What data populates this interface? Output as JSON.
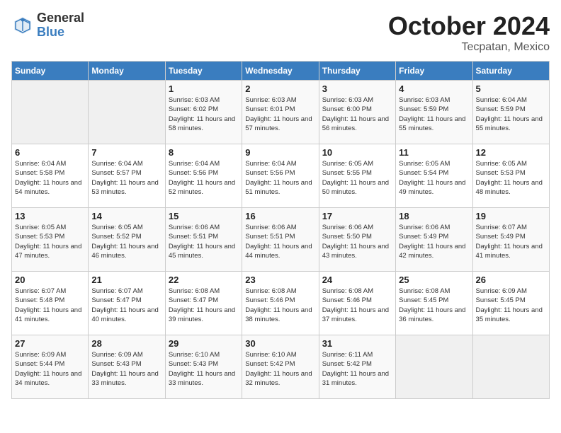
{
  "logo": {
    "general": "General",
    "blue": "Blue"
  },
  "title": "October 2024",
  "location": "Tecpatan, Mexico",
  "days_header": [
    "Sunday",
    "Monday",
    "Tuesday",
    "Wednesday",
    "Thursday",
    "Friday",
    "Saturday"
  ],
  "weeks": [
    [
      {
        "num": "",
        "info": ""
      },
      {
        "num": "",
        "info": ""
      },
      {
        "num": "1",
        "info": "Sunrise: 6:03 AM\nSunset: 6:02 PM\nDaylight: 11 hours and 58 minutes."
      },
      {
        "num": "2",
        "info": "Sunrise: 6:03 AM\nSunset: 6:01 PM\nDaylight: 11 hours and 57 minutes."
      },
      {
        "num": "3",
        "info": "Sunrise: 6:03 AM\nSunset: 6:00 PM\nDaylight: 11 hours and 56 minutes."
      },
      {
        "num": "4",
        "info": "Sunrise: 6:03 AM\nSunset: 5:59 PM\nDaylight: 11 hours and 55 minutes."
      },
      {
        "num": "5",
        "info": "Sunrise: 6:04 AM\nSunset: 5:59 PM\nDaylight: 11 hours and 55 minutes."
      }
    ],
    [
      {
        "num": "6",
        "info": "Sunrise: 6:04 AM\nSunset: 5:58 PM\nDaylight: 11 hours and 54 minutes."
      },
      {
        "num": "7",
        "info": "Sunrise: 6:04 AM\nSunset: 5:57 PM\nDaylight: 11 hours and 53 minutes."
      },
      {
        "num": "8",
        "info": "Sunrise: 6:04 AM\nSunset: 5:56 PM\nDaylight: 11 hours and 52 minutes."
      },
      {
        "num": "9",
        "info": "Sunrise: 6:04 AM\nSunset: 5:56 PM\nDaylight: 11 hours and 51 minutes."
      },
      {
        "num": "10",
        "info": "Sunrise: 6:05 AM\nSunset: 5:55 PM\nDaylight: 11 hours and 50 minutes."
      },
      {
        "num": "11",
        "info": "Sunrise: 6:05 AM\nSunset: 5:54 PM\nDaylight: 11 hours and 49 minutes."
      },
      {
        "num": "12",
        "info": "Sunrise: 6:05 AM\nSunset: 5:53 PM\nDaylight: 11 hours and 48 minutes."
      }
    ],
    [
      {
        "num": "13",
        "info": "Sunrise: 6:05 AM\nSunset: 5:53 PM\nDaylight: 11 hours and 47 minutes."
      },
      {
        "num": "14",
        "info": "Sunrise: 6:05 AM\nSunset: 5:52 PM\nDaylight: 11 hours and 46 minutes."
      },
      {
        "num": "15",
        "info": "Sunrise: 6:06 AM\nSunset: 5:51 PM\nDaylight: 11 hours and 45 minutes."
      },
      {
        "num": "16",
        "info": "Sunrise: 6:06 AM\nSunset: 5:51 PM\nDaylight: 11 hours and 44 minutes."
      },
      {
        "num": "17",
        "info": "Sunrise: 6:06 AM\nSunset: 5:50 PM\nDaylight: 11 hours and 43 minutes."
      },
      {
        "num": "18",
        "info": "Sunrise: 6:06 AM\nSunset: 5:49 PM\nDaylight: 11 hours and 42 minutes."
      },
      {
        "num": "19",
        "info": "Sunrise: 6:07 AM\nSunset: 5:49 PM\nDaylight: 11 hours and 41 minutes."
      }
    ],
    [
      {
        "num": "20",
        "info": "Sunrise: 6:07 AM\nSunset: 5:48 PM\nDaylight: 11 hours and 41 minutes."
      },
      {
        "num": "21",
        "info": "Sunrise: 6:07 AM\nSunset: 5:47 PM\nDaylight: 11 hours and 40 minutes."
      },
      {
        "num": "22",
        "info": "Sunrise: 6:08 AM\nSunset: 5:47 PM\nDaylight: 11 hours and 39 minutes."
      },
      {
        "num": "23",
        "info": "Sunrise: 6:08 AM\nSunset: 5:46 PM\nDaylight: 11 hours and 38 minutes."
      },
      {
        "num": "24",
        "info": "Sunrise: 6:08 AM\nSunset: 5:46 PM\nDaylight: 11 hours and 37 minutes."
      },
      {
        "num": "25",
        "info": "Sunrise: 6:08 AM\nSunset: 5:45 PM\nDaylight: 11 hours and 36 minutes."
      },
      {
        "num": "26",
        "info": "Sunrise: 6:09 AM\nSunset: 5:45 PM\nDaylight: 11 hours and 35 minutes."
      }
    ],
    [
      {
        "num": "27",
        "info": "Sunrise: 6:09 AM\nSunset: 5:44 PM\nDaylight: 11 hours and 34 minutes."
      },
      {
        "num": "28",
        "info": "Sunrise: 6:09 AM\nSunset: 5:43 PM\nDaylight: 11 hours and 33 minutes."
      },
      {
        "num": "29",
        "info": "Sunrise: 6:10 AM\nSunset: 5:43 PM\nDaylight: 11 hours and 33 minutes."
      },
      {
        "num": "30",
        "info": "Sunrise: 6:10 AM\nSunset: 5:42 PM\nDaylight: 11 hours and 32 minutes."
      },
      {
        "num": "31",
        "info": "Sunrise: 6:11 AM\nSunset: 5:42 PM\nDaylight: 11 hours and 31 minutes."
      },
      {
        "num": "",
        "info": ""
      },
      {
        "num": "",
        "info": ""
      }
    ]
  ]
}
